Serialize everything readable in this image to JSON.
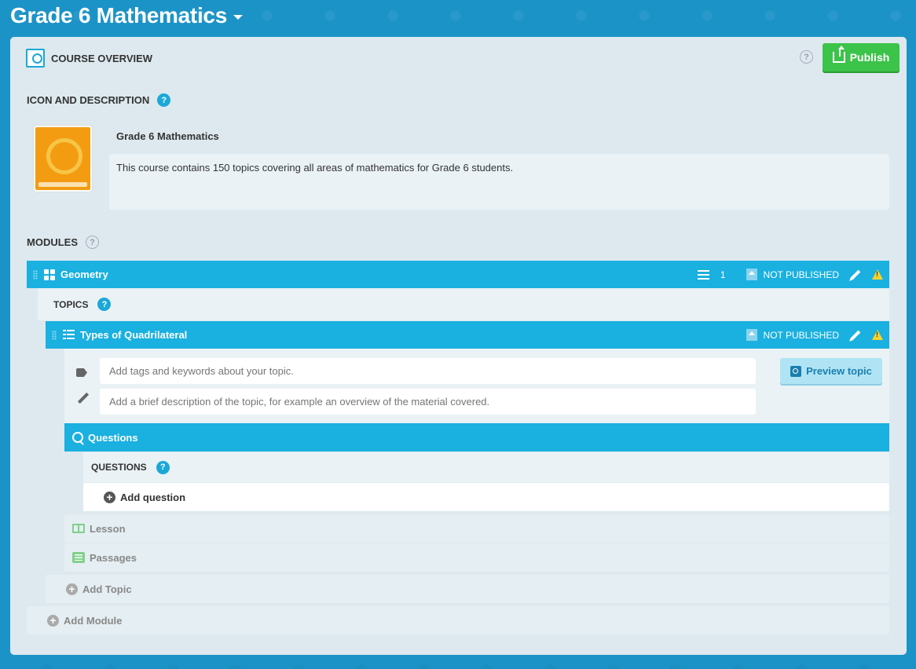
{
  "app": {
    "title": "Grade 6 Mathematics"
  },
  "overview": {
    "label": "COURSE OVERVIEW",
    "help": "?",
    "publish_label": "Publish"
  },
  "icon_description": {
    "label": "ICON AND DESCRIPTION",
    "help": "?",
    "course_name": "Grade 6 Mathematics",
    "description": "This course contains 150 topics covering all areas of mathematics for Grade 6 students."
  },
  "modules": {
    "label": "MODULES",
    "help": "?",
    "add_module_label": "Add Module",
    "items": [
      {
        "name": "Geometry",
        "topic_count": "1",
        "status": "NOT PUBLISHED",
        "topics_label": "TOPICS",
        "topics_help": "?",
        "add_topic_label": "Add Topic",
        "topics": [
          {
            "name": "Types of Quadrilateral",
            "status": "NOT PUBLISHED",
            "tags_placeholder": "Add tags and keywords about your topic.",
            "description_placeholder": "Add a brief description of the topic, for example an overview of the material covered.",
            "preview_label": "Preview topic",
            "questions_bar_label": "Questions",
            "questions_label": "QUESTIONS",
            "questions_help": "?",
            "add_question_label": "Add question",
            "lesson_label": "Lesson",
            "passages_label": "Passages"
          }
        ]
      }
    ]
  },
  "colors": {
    "background": "#1c93c7",
    "panel": "#dde9ef",
    "bar": "#1ab0e0",
    "publish": "#3cc34a",
    "book": "#f39c12",
    "warning": "#f6d32d"
  }
}
